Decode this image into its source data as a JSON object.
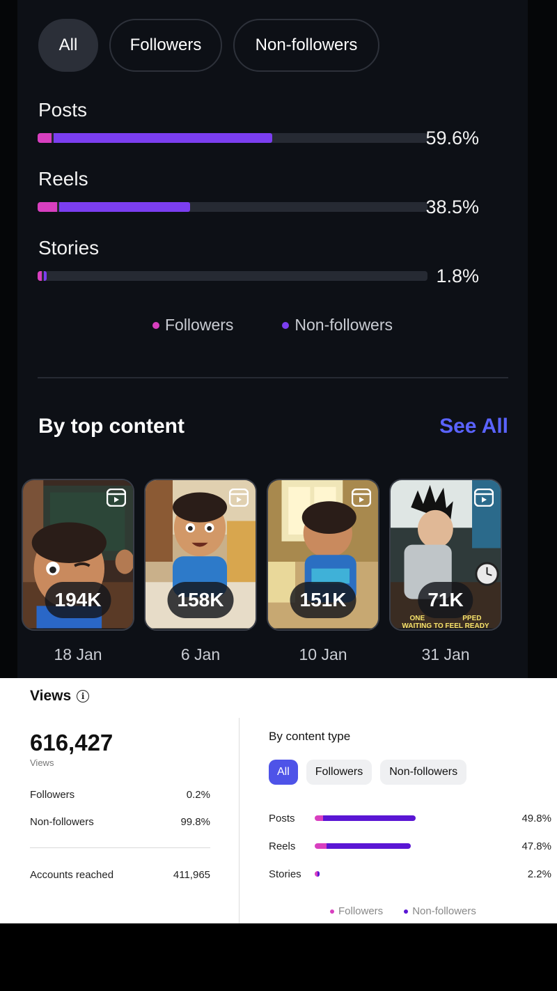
{
  "top_panel": {
    "tabs": [
      {
        "label": "All",
        "active": true
      },
      {
        "label": "Followers",
        "active": false
      },
      {
        "label": "Non-followers",
        "active": false
      }
    ],
    "content_types": [
      {
        "label": "Posts",
        "percent": "59.6%",
        "followers_share": 0.035,
        "non_followers_share": 0.561
      },
      {
        "label": "Reels",
        "percent": "38.5%",
        "followers_share": 0.05,
        "non_followers_share": 0.335
      },
      {
        "label": "Stories",
        "percent": "1.8%",
        "followers_share": 0.01,
        "non_followers_share": 0.008
      }
    ],
    "legend": {
      "followers": "Followers",
      "non_followers": "Non-followers"
    },
    "section_title": "By top content",
    "see_all": "See All",
    "top_content": [
      {
        "views": "194K",
        "date": "18 Jan",
        "icon": "reel-icon"
      },
      {
        "views": "158K",
        "date": "6 Jan",
        "icon": "reel-icon"
      },
      {
        "views": "151K",
        "date": "10 Jan",
        "icon": "reel-icon"
      },
      {
        "views": "71K",
        "date": "31 Jan",
        "icon": "reel-icon",
        "caption_line1": "ONE ⠀⠀⠀⠀⠀⠀⠀PPED",
        "caption_line2": "WAITING TO FEEL READY"
      }
    ],
    "colors": {
      "followers": "#d83fbf",
      "non_followers": "#7b3ef0",
      "see_all": "#5a63ff"
    }
  },
  "bottom_panel": {
    "title": "Views",
    "info_icon": "info-icon",
    "total": "616,427",
    "total_label": "Views",
    "breakdown": [
      {
        "label": "Followers",
        "value": "0.2%"
      },
      {
        "label": "Non-followers",
        "value": "99.8%"
      }
    ],
    "accounts_reached": {
      "label": "Accounts reached",
      "value": "411,965"
    },
    "by_content_type": {
      "title": "By content type",
      "tabs": [
        {
          "label": "All",
          "active": true
        },
        {
          "label": "Followers",
          "active": false
        },
        {
          "label": "Non-followers",
          "active": false
        }
      ],
      "rows": [
        {
          "label": "Posts",
          "percent": "49.8%",
          "followers_share": 0.04,
          "non_followers_share": 0.458
        },
        {
          "label": "Reels",
          "percent": "47.8%",
          "followers_share": 0.06,
          "non_followers_share": 0.418
        },
        {
          "label": "Stories",
          "percent": "2.2%",
          "followers_share": 0.012,
          "non_followers_share": 0.01
        }
      ],
      "legend": {
        "followers": "Followers",
        "non_followers": "Non-followers"
      }
    },
    "colors": {
      "accent": "#4e53e8",
      "followers": "#d83fbf",
      "non_followers": "#5a16d4"
    }
  }
}
